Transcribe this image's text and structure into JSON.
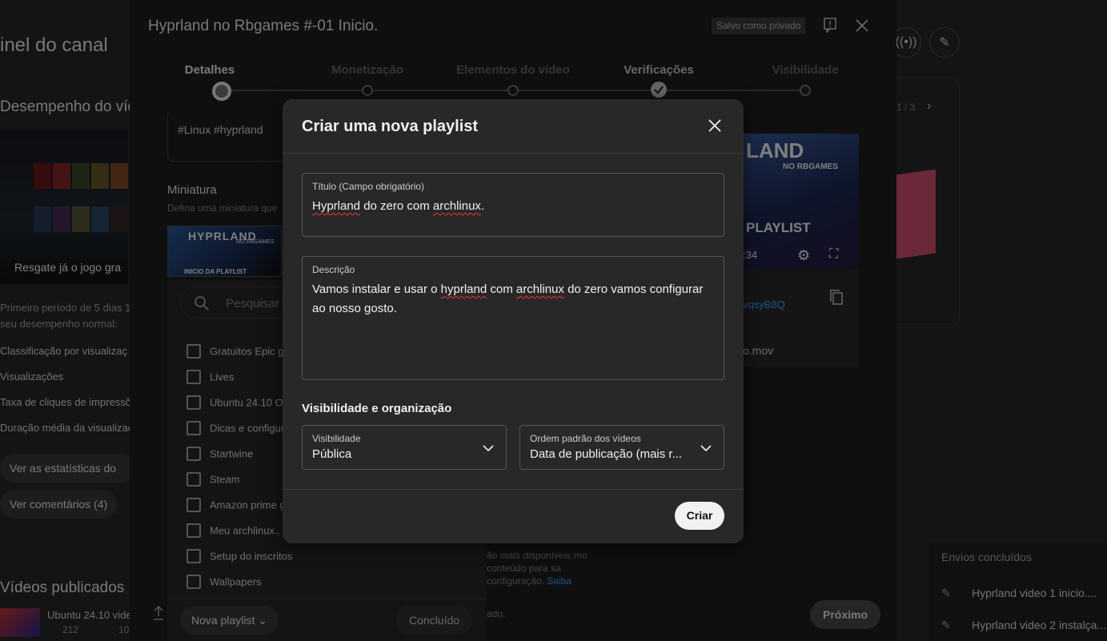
{
  "dashboard": {
    "title": "inel do canal",
    "performance_heading": "Desempenho do víde",
    "thumb_caption": "Resgate já o jogo gra",
    "period_text_1": "Primeiro período de 5 dias 13",
    "period_text_2": "seu desempenho normal:",
    "metrics": [
      "Classificação por visualizaç",
      "Visualizações",
      "Taxa de cliques de impressõ",
      "Duração média da visualizaç"
    ],
    "stats_button": "Ver as estatísticas do ví",
    "comments_button": "Ver comentários (4)",
    "published_heading": "Vídeos publicados",
    "published_item": "Ubuntu 24.10 vide",
    "published_views": "212",
    "published_comments": "10",
    "pager": "1 / 3",
    "envios": {
      "heading": "Envios concluídos",
      "items": [
        "Hyprland video 1 inicio....",
        "Hyprland video 2 instalça..."
      ]
    }
  },
  "upload": {
    "title": "Hyprland no Rbgames #-01 Inicio.",
    "badge": "Salvo como privado",
    "steps": [
      "Detalhes",
      "Monetização",
      "Elementos do vídeo",
      "Verificações",
      "Visibilidade"
    ],
    "tags_text": "#Linux #hyprland",
    "thumbnail_label": "Miniatura",
    "thumbnail_sub": "Defina uma miniatura que",
    "thumb_title": "HYPRLAND",
    "thumb_sub": "NO RBGAMES",
    "thumb_bottom": "INICIO DA PLAYLIST",
    "playlist_search_placeholder": "Pesquisar",
    "playlists": [
      "Gratuitos Epic g",
      "Lives",
      "Ubuntu 24.10 Oc",
      "Dicas e configur",
      "Startwine",
      "Steam",
      "Amazon prime g",
      "Meu archlinux..",
      "Setup do inscritos",
      "Wallpapers"
    ],
    "new_playlist_button": "Nova playlist",
    "done_button": "Concluído",
    "preview": {
      "title": "LAND",
      "subtitle": "NO RBGAMES",
      "label": "PLAYLIST",
      "time": ":34",
      "link": "vqsyB8Q",
      "filename": "o.mov"
    },
    "note": "ão mais disponíveis mo conteúdo para sa configuração.",
    "note_link": "Saiba",
    "note2": "ado.",
    "next_button": "Próximo"
  },
  "modal": {
    "title": "Criar uma nova playlist",
    "title_field": {
      "label": "Título (Campo obrigatório)",
      "value_parts": [
        "Hyprland",
        " do zero com ",
        "archlinux",
        "."
      ]
    },
    "description_field": {
      "label": "Descrição",
      "value_parts": [
        "Vamos instalar e usar o ",
        "hyprland",
        " com ",
        "archlinux",
        " do zero vamos configurar\nao nosso gosto."
      ]
    },
    "section_heading": "Visibilidade e organização",
    "visibility": {
      "label": "Visibilidade",
      "value": "Pública"
    },
    "order": {
      "label": "Ordem padrão dos vídeos",
      "value": "Data de publicação (mais r..."
    },
    "create_button": "Criar"
  }
}
